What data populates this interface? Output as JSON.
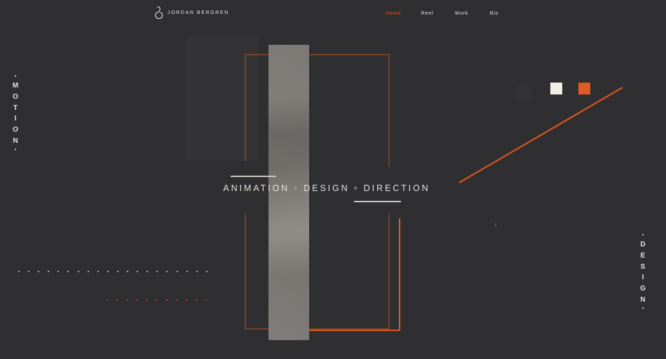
{
  "header": {
    "brand": "JORDAN BERGREN",
    "nav": [
      {
        "label": "Home",
        "active": true
      },
      {
        "label": "Reel",
        "active": false
      },
      {
        "label": "Work",
        "active": false
      },
      {
        "label": "Bio",
        "active": false
      }
    ]
  },
  "side_left": {
    "dot_top": "•",
    "letters": [
      "M",
      "O",
      "T",
      "I",
      "O",
      "N"
    ],
    "dot_bottom": "•"
  },
  "side_right": {
    "dot_top": "•",
    "letters": [
      "D",
      "E",
      "S",
      "I",
      "G",
      "N"
    ],
    "dot_bottom": "•"
  },
  "headline": {
    "part1": "ANIMATION",
    "sep1": "+",
    "part2": "DESIGN",
    "sep2": "+",
    "part3": "DIRECTION"
  },
  "colors": {
    "background": "#2f2e30",
    "accent": "#e05a23",
    "cream": "#f3efe6",
    "dark_swatch": "#333234"
  },
  "icons": {
    "logo": "ampersand-loop-logo-icon"
  }
}
